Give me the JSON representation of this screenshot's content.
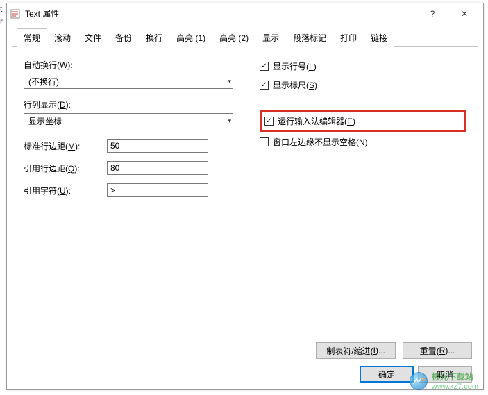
{
  "titlebar": {
    "title": "Text 属性",
    "help": "?",
    "close": "✕"
  },
  "tabs": [
    "常规",
    "滚动",
    "文件",
    "备份",
    "换行",
    "高亮 (1)",
    "高亮 (2)",
    "显示",
    "段落标记",
    "打印",
    "链接"
  ],
  "active_tab_index": 0,
  "left": {
    "autowrap_label": "自动换行(W):",
    "autowrap_value": "(不换行)",
    "rowcol_label": "行列显示(D):",
    "rowcol_value": "显示坐标",
    "margin_label": "标准行边距(M):",
    "margin_value": "50",
    "quote_margin_label": "引用行边距(Q):",
    "quote_margin_value": "80",
    "quote_char_label": "引用字符(U):",
    "quote_char_value": ">"
  },
  "right": {
    "show_lineno": "显示行号(L)",
    "show_ruler": "显示标尺(S)",
    "run_ime": "运行输入法编辑器(E)",
    "no_left_space": "窗口左边缘不显示空格(N)"
  },
  "footer": {
    "tab_indent": "制表符/缩进(I)...",
    "reset": "重置(R)..."
  },
  "footer2": {
    "ok": "确定",
    "cancel": "取消"
  },
  "watermark": {
    "name": "极光下载站",
    "url": "www.xz7.com"
  },
  "left_cut": {
    "t": "t",
    "r": "r"
  }
}
